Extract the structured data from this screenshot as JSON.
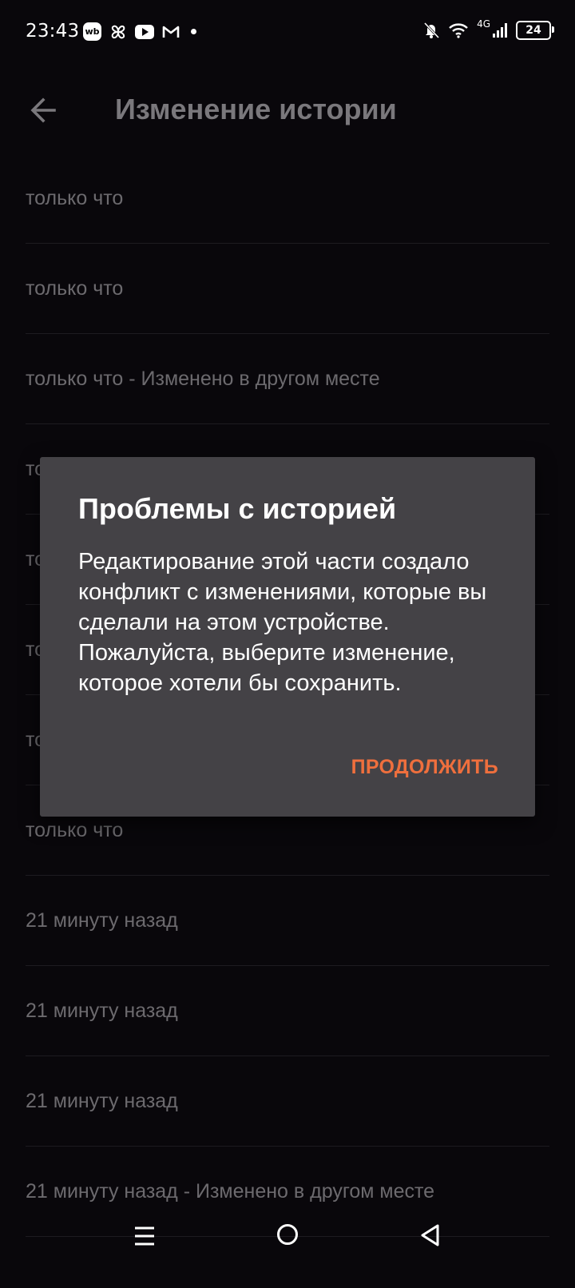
{
  "status_bar": {
    "time": "23:43",
    "left_icons": [
      "wb-icon",
      "pinwheel-icon",
      "youtube-icon",
      "gmail-icon",
      "notification-dot"
    ],
    "wb_label": "wb",
    "network_label": "4G",
    "battery_level": "24",
    "right_icons": [
      "bell-off-icon",
      "wifi-icon",
      "signal-icon",
      "battery-icon"
    ]
  },
  "app_bar": {
    "title": "Изменение истории",
    "back_icon": "arrow-left-icon"
  },
  "history": {
    "items": [
      "только что",
      "только что",
      "только что - Изменено в другом месте",
      "то",
      "то",
      "то",
      "то",
      "только что",
      "21 минуту назад",
      "21 минуту назад",
      "21 минуту назад",
      "21 минуту назад - Изменено в другом месте"
    ]
  },
  "dialog": {
    "title": "Проблемы с историей",
    "message": "Редактирование этой части создало конфликт с изменениями, которые вы сделали на этом устройстве. Пожалуйста, выберите изменение, которое хотели бы сохранить.",
    "action_label": "ПРОДОЛЖИТЬ"
  },
  "navigation_bar": {
    "buttons": [
      "menu-icon",
      "home-circle-icon",
      "back-triangle-icon"
    ]
  },
  "colors": {
    "background": "#09070b",
    "dialog_background": "#444246",
    "accent": "#ef6f3d",
    "muted_text": "#6c6a6e"
  }
}
